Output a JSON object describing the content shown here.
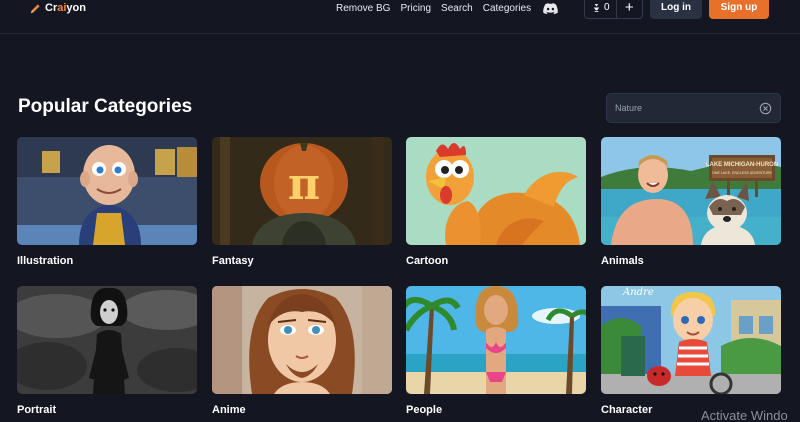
{
  "brand": {
    "name_pre": "Cr",
    "name_ai": "ai",
    "name_post": "yon"
  },
  "nav": {
    "items": [
      "Remove BG",
      "Pricing",
      "Search",
      "Categories"
    ]
  },
  "credits": {
    "count": "0",
    "plus": "+"
  },
  "auth": {
    "login": "Log in",
    "signup": "Sign up"
  },
  "section": {
    "title": "Popular Categories"
  },
  "search": {
    "placeholder": "Nature"
  },
  "categories": [
    {
      "label": "Illustration"
    },
    {
      "label": "Fantasy"
    },
    {
      "label": "Cartoon"
    },
    {
      "label": "Animals"
    },
    {
      "label": "Portrait"
    },
    {
      "label": "Anime"
    },
    {
      "label": "People"
    },
    {
      "label": "Character"
    }
  ],
  "image_text": {
    "animals_sign_line1": "LAKE MICHIGAN-HURON",
    "animals_sign_line2": "ONE LAKE, ENDLESS ADVENTURE",
    "fantasy_symbol": "π",
    "character_script": "Andre"
  },
  "os_watermark": "Activate Windo",
  "colors": {
    "background": "#141722",
    "accent": "#e7702a",
    "login_bg": "#2a3142"
  }
}
